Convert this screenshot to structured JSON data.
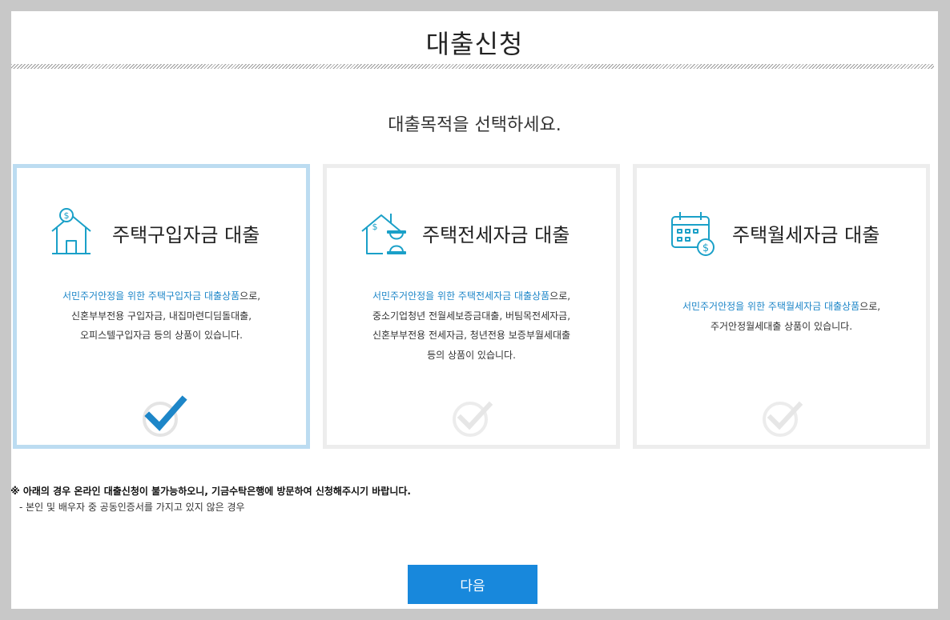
{
  "page": {
    "title": "대출신청",
    "subtitle": "대출목적을 선택하세요."
  },
  "cards": [
    {
      "title": "주택구입자금 대출",
      "icon": "house-coin-icon",
      "selected": true,
      "desc_highlight": "서민주거안정을 위한 주택구입자금 대출상품",
      "desc_suffix": "으로,",
      "desc_lines": [
        "신혼부부전용 구입자금, 내집마련디딤돌대출,",
        "오피스텔구입자금 등의 상품이 있습니다."
      ]
    },
    {
      "title": "주택전세자금 대출",
      "icon": "house-hourglass-icon",
      "selected": false,
      "desc_highlight": "서민주거안정을 위한 주택전세자금 대출상품",
      "desc_suffix": "으로,",
      "desc_lines": [
        "중소기업청년 전월세보증금대출, 버팀목전세자금,",
        "신혼부부전용 전세자금, 청년전용 보증부월세대출",
        "등의 상품이 있습니다."
      ]
    },
    {
      "title": "주택월세자금 대출",
      "icon": "calendar-coin-icon",
      "selected": false,
      "desc_highlight": "서민주거안정을 위한 주택월세자금 대출상품",
      "desc_suffix": "으로,",
      "desc_lines": [
        "주거안정월세대출 상품이 있습니다."
      ]
    }
  ],
  "notice": {
    "line1": "※ 아래의 경우 온라인 대출신청이 불가능하오니, 기금수탁은행에 방문하여 신청해주시기 바랍니다.",
    "line2": "- 본인 및 배우자 중 공동인증서를 가지고 있지 않은 경우"
  },
  "buttons": {
    "next_label": "다음"
  },
  "colors": {
    "accent": "#1888dc",
    "highlight_text": "#1d86c8",
    "icon_teal": "#1aa0c8",
    "selected_border": "#bcdcf1"
  }
}
